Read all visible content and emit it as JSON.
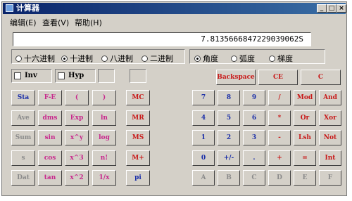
{
  "window": {
    "title": "计算器",
    "controls": [
      "_",
      "□",
      "×"
    ]
  },
  "menu": [
    "编辑(E)",
    "查看(V)",
    "帮助(H)"
  ],
  "display": {
    "value": "7.8135666847229039062S"
  },
  "base_modes": {
    "options": [
      "十六进制",
      "十进制",
      "八进制",
      "二进制"
    ],
    "selected": "十进制"
  },
  "angle_modes": {
    "options": [
      "角度",
      "弧度",
      "梯度"
    ],
    "selected": "角度"
  },
  "checkboxes": {
    "inv": "Inv",
    "hyp": "Hyp"
  },
  "top_buttons": [
    "Backspace",
    "CE",
    "C"
  ],
  "sci_buttons": [
    [
      "Sta",
      "F-E",
      "(",
      ")"
    ],
    [
      "Ave",
      "dms",
      "Exp",
      "ln"
    ],
    [
      "Sum",
      "sin",
      "x^y",
      "log"
    ],
    [
      "s",
      "cos",
      "x^3",
      "n!"
    ],
    [
      "Dat",
      "tan",
      "x^2",
      "1/x"
    ]
  ],
  "memory_buttons": [
    "MC",
    "MR",
    "MS",
    "M+",
    "pi"
  ],
  "num_rows": [
    [
      "7",
      "8",
      "9",
      "/",
      "Mod",
      "And"
    ],
    [
      "4",
      "5",
      "6",
      "*",
      "Or",
      "Xor"
    ],
    [
      "1",
      "2",
      "3",
      "-",
      "Lsh",
      "Not"
    ],
    [
      "0",
      "+/-",
      ".",
      "+",
      "=",
      "Int"
    ],
    [
      "A",
      "B",
      "C",
      "D",
      "E",
      "F"
    ]
  ],
  "colors": {
    "blue": "#1a2ea8",
    "magenta": "#c8268c",
    "red": "#c81818",
    "disabled": "#8a8a8a",
    "face": "#d4d0c8"
  }
}
